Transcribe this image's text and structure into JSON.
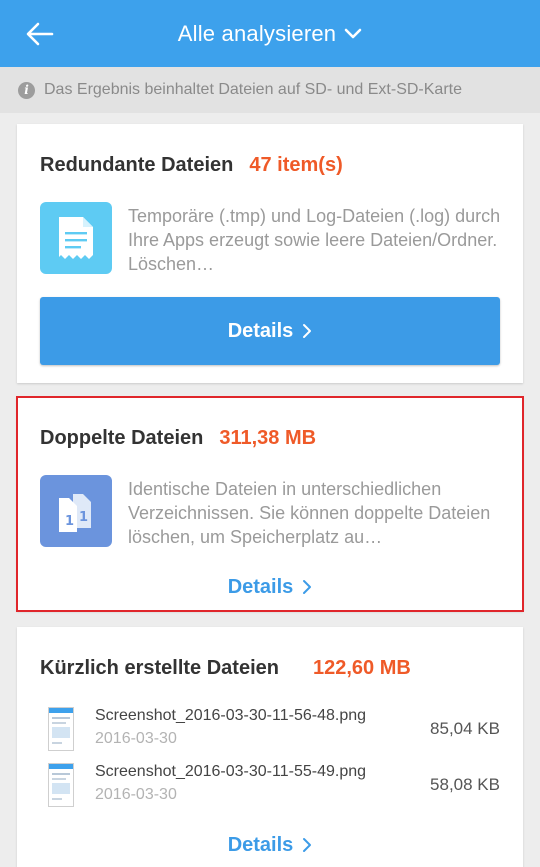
{
  "header": {
    "title": "Alle analysieren",
    "back_icon": "arrow-left-icon",
    "dropdown_icon": "chevron-down-icon"
  },
  "notice": {
    "icon": "info-icon",
    "icon_glyph": "i",
    "text": "Das Ergebnis beinhaltet Dateien auf SD- und Ext-SD-Karte"
  },
  "cards": [
    {
      "title": "Redundante Dateien",
      "count": "47 item(s)",
      "icon": "document-icon",
      "icon_color": "#5ecbf3",
      "description": "Temporäre (.tmp) und Log-Dateien (.log) durch Ihre Apps erzeugt sowie leere Dateien/Ordner. Löschen…",
      "button_label": "Details"
    },
    {
      "title": "Doppelte Dateien",
      "count": "311,38 MB",
      "icon": "duplicate-files-icon",
      "icon_color": "#6b94dd",
      "description": "Identische Dateien in unterschiedlichen Verzeichnissen. Sie können doppelte Dateien löschen, um Speicherplatz au…",
      "button_label": "Details"
    },
    {
      "title": "Kürzlich erstellte Dateien",
      "count": "122,60 MB",
      "files": [
        {
          "name": "Screenshot_2016-03-30-11-56-48.png",
          "date": "2016-03-30",
          "size": "85,04 KB"
        },
        {
          "name": "Screenshot_2016-03-30-11-55-49.png",
          "date": "2016-03-30",
          "size": "58,08 KB"
        }
      ],
      "button_label": "Details"
    }
  ],
  "colors": {
    "appbar": "#3da1ec",
    "accent_orange": "#ef5a28",
    "button_blue": "#3c9be7",
    "highlight_border": "#e0262b"
  }
}
